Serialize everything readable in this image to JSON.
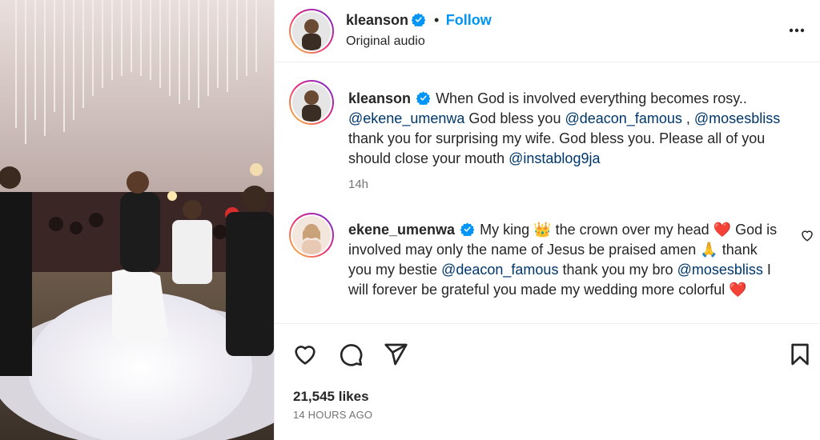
{
  "post": {
    "author": "kleanson",
    "header_separator": "•",
    "follow_label": "Follow",
    "audio_label": "Original audio"
  },
  "caption": {
    "author": "kleanson",
    "text_1": "When God is involved everything becomes rosy..",
    "mention_1": "@ekene_umenwa",
    "text_2": "God bless you",
    "mention_2": "@deacon_famous",
    "text_3": ",",
    "mention_3": "@mosesbliss",
    "text_4": "thank you for surprising my wife. God bless you. Please all of you should close your mouth",
    "mention_4": "@instablog9ja",
    "time": "14h"
  },
  "comment": {
    "author": "ekene_umenwa",
    "text_1": "My king",
    "emoji_crown": "👑",
    "text_2": "the crown over my head",
    "emoji_heart": "❤️",
    "text_3": "God is involved may only the name of Jesus be praised amen",
    "emoji_pray": "🙏",
    "text_4": "thank you my bestie",
    "mention_1": "@deacon_famous",
    "text_5": "thank you my bro",
    "mention_2": "@mosesbliss",
    "text_6": "I will forever be grateful you made my wedding more colorful",
    "emoji_heart_2": "❤️"
  },
  "stats": {
    "likes": "21,545 likes",
    "posted_ago": "14 HOURS AGO"
  },
  "icons": {
    "verified": "verified-badge-icon",
    "more": "more-options-icon",
    "like": "heart-icon",
    "comment": "comment-icon",
    "share": "share-icon",
    "save": "bookmark-icon",
    "comment_like": "heart-icon"
  },
  "colors": {
    "accent": "#0095f6",
    "mention": "#00376b",
    "muted": "#737373",
    "heart_red": "#ed4956"
  }
}
